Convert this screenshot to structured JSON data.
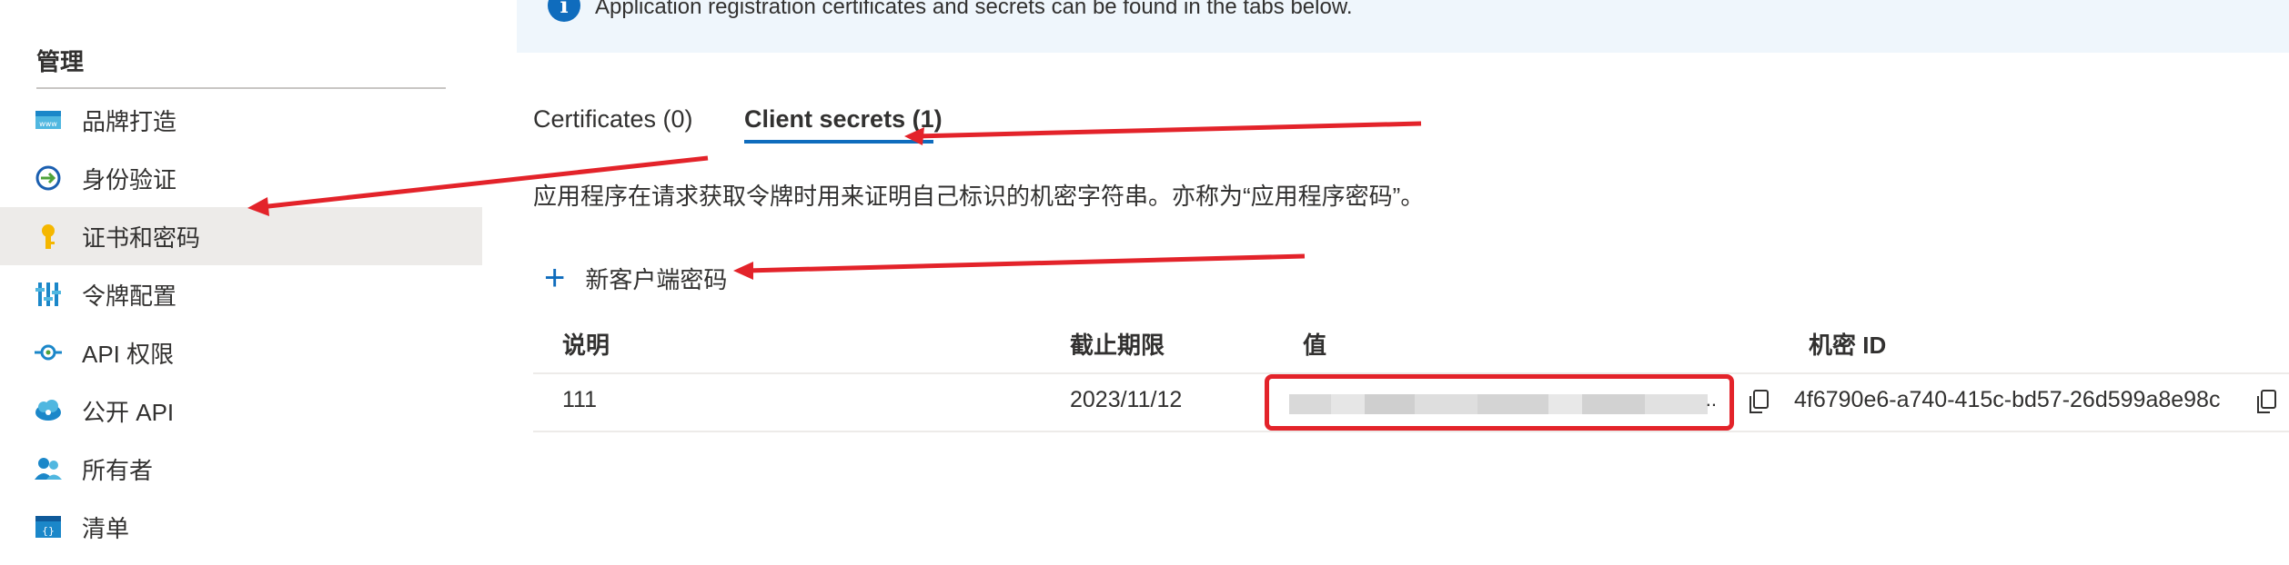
{
  "sidebar": {
    "section_title": "管理",
    "items": [
      {
        "label": "品牌打造",
        "icon": "branding-icon"
      },
      {
        "label": "身份验证",
        "icon": "authentication-icon"
      },
      {
        "label": "证书和密码",
        "icon": "key-icon",
        "selected": true
      },
      {
        "label": "令牌配置",
        "icon": "token-config-icon"
      },
      {
        "label": "API 权限",
        "icon": "api-permissions-icon"
      },
      {
        "label": "公开 API",
        "icon": "expose-api-icon"
      },
      {
        "label": "所有者",
        "icon": "owners-icon"
      },
      {
        "label": "清单",
        "icon": "manifest-icon"
      }
    ]
  },
  "banner": {
    "text": "Application registration certificates and secrets can be found in the tabs below."
  },
  "tabs": [
    {
      "label": "Certificates (0)"
    },
    {
      "label": "Client secrets (1)",
      "selected": true
    }
  ],
  "description": "应用程序在请求获取令牌时用来证明自己标识的机密字符串。亦称为“应用程序密码”。",
  "new_secret_label": "新客户端密码",
  "table": {
    "headers": [
      "说明",
      "截止期限",
      "值",
      "机密 ID"
    ],
    "rows": [
      {
        "description": "111",
        "expires": "2023/11/12",
        "value_suffix": "..",
        "secret_id": "4f6790e6-a740-415c-bd57-26d599a8e98c"
      }
    ]
  },
  "colors": {
    "accent": "#0f6cbd",
    "highlight": "#e3232a",
    "banner_bg": "#eff6fc",
    "selected_bg": "#edebe9"
  }
}
